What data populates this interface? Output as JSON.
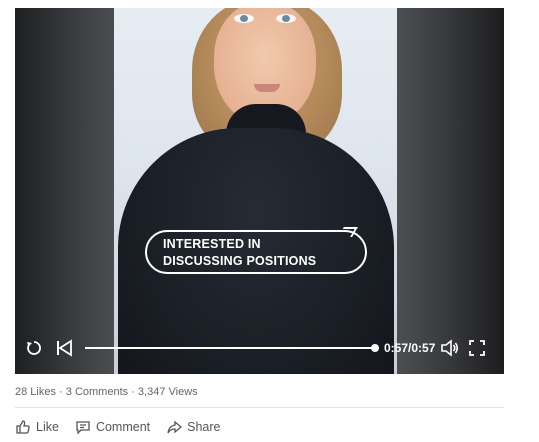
{
  "video": {
    "caption_line1": "INTERESTED IN",
    "caption_line2": "DISCUSSING POSITIONS",
    "time_display": "0:57/0:57",
    "progress": 1.0,
    "controls": {
      "replay_icon": "replay-icon",
      "previous_icon": "skip-back-icon",
      "volume_icon": "volume-icon",
      "fullscreen_icon": "fullscreen-icon"
    }
  },
  "stats": {
    "likes": "28 Likes",
    "separator": " · ",
    "comments": "3 Comments",
    "views": "3,347 Views"
  },
  "actions": {
    "like_label": "Like",
    "comment_label": "Comment",
    "share_label": "Share"
  }
}
